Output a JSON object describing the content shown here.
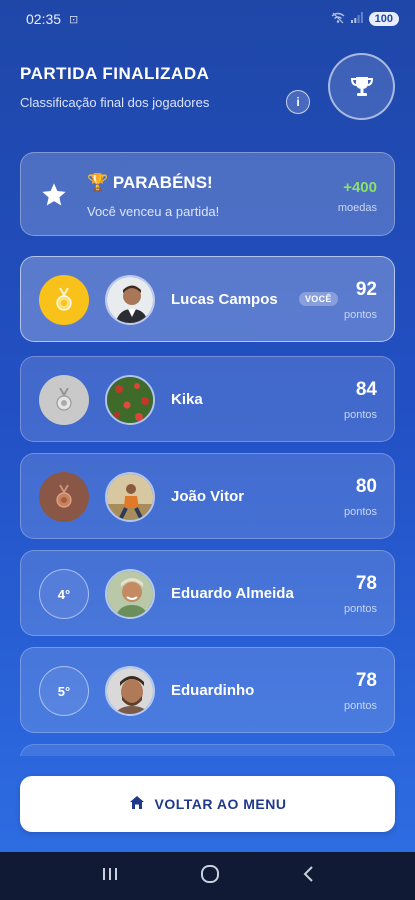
{
  "status_bar": {
    "time": "02:35",
    "battery": "100"
  },
  "header": {
    "title": "PARTIDA FINALIZADA",
    "subtitle": "Classificação final dos jogadores",
    "info_icon": "info-icon",
    "trophy_icon": "trophy-icon"
  },
  "congrats": {
    "icon": "star-icon",
    "title": "🏆 PARABÉNS!",
    "message": "Você venceu a partida!",
    "coins": "+400",
    "coins_label": "moedas"
  },
  "players": [
    {
      "rank": "1",
      "medal": "gold",
      "name": "Lucas Campos",
      "badge": "VOCÊ",
      "score": "92",
      "score_label": "pontos"
    },
    {
      "rank": "2",
      "medal": "silver",
      "name": "Kika",
      "score": "84",
      "score_label": "pontos"
    },
    {
      "rank": "3",
      "medal": "bronze",
      "name": "João Vitor",
      "score": "80",
      "score_label": "pontos"
    },
    {
      "rank": "4°",
      "medal": "plain",
      "name": "Eduardo Almeida",
      "score": "78",
      "score_label": "pontos"
    },
    {
      "rank": "5°",
      "medal": "plain",
      "name": "Eduardinho",
      "score": "78",
      "score_label": "pontos"
    }
  ],
  "back_button": {
    "label": "VOLTAR AO MENU",
    "icon": "home-icon"
  },
  "colors": {
    "bg_top": "#1f47a8",
    "bg_bottom": "#2f6fe6",
    "gold": "#f8c21a",
    "silver": "#c9c9c9",
    "bronze": "#8a5746",
    "coins": "#8ae06a"
  }
}
